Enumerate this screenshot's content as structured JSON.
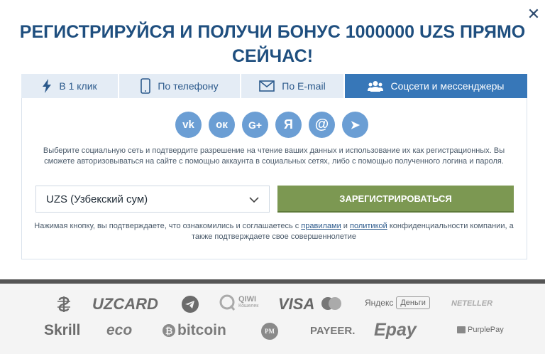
{
  "modal": {
    "title": "РЕГИСТРИРУЙСЯ И ПОЛУЧИ БОНУС 1000000 UZS ПРЯМО СЕЙЧАС!",
    "close_symbol": "✕"
  },
  "tabs": [
    {
      "label": "В 1 клик",
      "icon": "lightning-icon",
      "active": false
    },
    {
      "label": "По телефону",
      "icon": "phone-icon",
      "active": false
    },
    {
      "label": "По E-mail",
      "icon": "envelope-icon",
      "active": false
    },
    {
      "label": "Соцсети и мессенджеры",
      "icon": "users-icon",
      "active": true
    }
  ],
  "socials": [
    {
      "name": "vk",
      "glyph": "vk"
    },
    {
      "name": "odnoklassniki",
      "glyph": "ок"
    },
    {
      "name": "google-plus",
      "glyph": "G+"
    },
    {
      "name": "yandex",
      "glyph": "Я"
    },
    {
      "name": "mail-ru",
      "glyph": "@"
    },
    {
      "name": "telegram",
      "glyph": "➤"
    }
  ],
  "description": "Выберите социальную сеть и подтвердите разрешение на чтение ваших данных и использование их как регистрационных. Вы сможете авторизовываться на сайте с помощью аккаунта в социальных сетях, либо с помощью полученного логина и пароля.",
  "currency": {
    "selected": "UZS (Узбекский сум)"
  },
  "register_label": "ЗАРЕГИСТРИРОВАТЬСЯ",
  "terms": {
    "before": "Нажимая кнопку, вы подтверждаете, что ознакомились и соглашаетесь с ",
    "rules_link": "правилами",
    "and": " и ",
    "policy_link": "политикой",
    "after": " конфиденциальности компании, а также подтверждаете свое совершеннолетие"
  },
  "payments": {
    "uzcard": "UZCARD",
    "qiwi": "QIWI",
    "qiwi_sub": "Кошелек",
    "visa": "VISA",
    "yandex": "Яндекс",
    "yandex_money": "Деньги",
    "neteller": "NETELLER",
    "skrill": "Skrill",
    "eco": "eco",
    "bitcoin": "bitcoin",
    "pm": "PM",
    "payeer": "PAYEER.",
    "epay": "Epay",
    "purplepay": "PurplePay"
  }
}
